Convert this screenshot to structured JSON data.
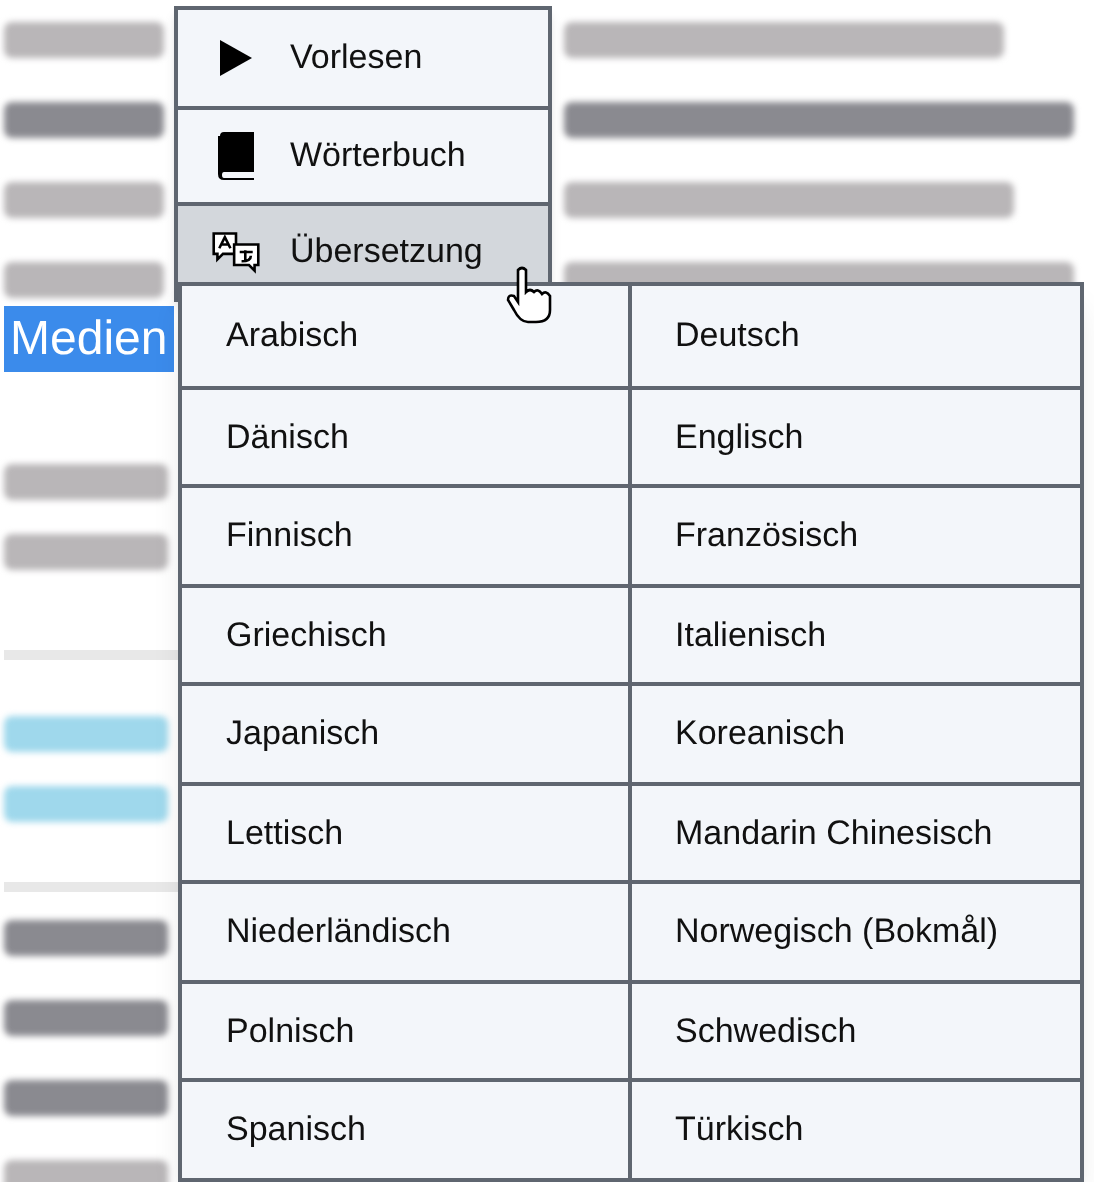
{
  "page": {
    "selected_text": "Medien"
  },
  "context_menu": {
    "items": [
      {
        "kind": "play",
        "label": "Vorlesen",
        "selected": false
      },
      {
        "kind": "book",
        "label": "Wörterbuch",
        "selected": false
      },
      {
        "kind": "translate",
        "label": "Übersetzung",
        "selected": true
      }
    ]
  },
  "language_menu": {
    "items": [
      {
        "label": "Arabisch"
      },
      {
        "label": "Deutsch"
      },
      {
        "label": "Dänisch"
      },
      {
        "label": "Englisch"
      },
      {
        "label": "Finnisch"
      },
      {
        "label": "Französisch"
      },
      {
        "label": "Griechisch"
      },
      {
        "label": "Italienisch"
      },
      {
        "label": "Japanisch"
      },
      {
        "label": "Koreanisch"
      },
      {
        "label": "Lettisch"
      },
      {
        "label": "Mandarin Chinesisch"
      },
      {
        "label": "Niederländisch"
      },
      {
        "label": "Norwegisch (Bokmål)"
      },
      {
        "label": "Polnisch"
      },
      {
        "label": "Schwedisch"
      },
      {
        "label": "Spanisch"
      },
      {
        "label": "Türkisch"
      }
    ]
  }
}
